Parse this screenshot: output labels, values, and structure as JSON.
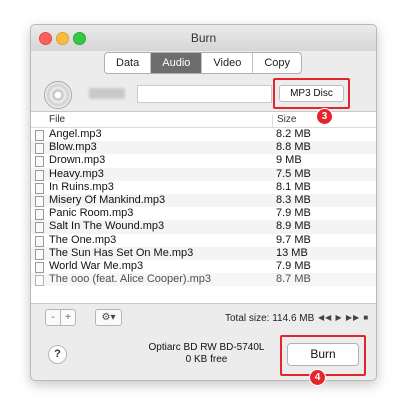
{
  "window": {
    "title": "Burn"
  },
  "tabs": [
    {
      "label": "Data",
      "active": false
    },
    {
      "label": "Audio",
      "active": true
    },
    {
      "label": "Video",
      "active": false
    },
    {
      "label": "Copy",
      "active": false
    }
  ],
  "disc": {
    "name_value": "",
    "format": "MP3 Disc"
  },
  "file_list": {
    "headers": {
      "file": "File",
      "size": "Size"
    },
    "rows": [
      {
        "name": "Angel.mp3",
        "size": "8.2 MB"
      },
      {
        "name": "Blow.mp3",
        "size": "8.8 MB"
      },
      {
        "name": "Drown.mp3",
        "size": "9 MB"
      },
      {
        "name": "Heavy.mp3",
        "size": "7.5 MB"
      },
      {
        "name": "In Ruins.mp3",
        "size": "8.1 MB"
      },
      {
        "name": "Misery Of Mankind.mp3",
        "size": "8.3 MB"
      },
      {
        "name": "Panic Room.mp3",
        "size": "7.9 MB"
      },
      {
        "name": "Salt In The Wound.mp3",
        "size": "8.9 MB"
      },
      {
        "name": "The One.mp3",
        "size": "9.7 MB"
      },
      {
        "name": "The Sun Has Set On Me.mp3",
        "size": "13 MB"
      },
      {
        "name": "World War Me.mp3",
        "size": "7.9 MB"
      },
      {
        "name": "The ooo (feat. Alice Cooper).mp3",
        "size": "8.7 MB"
      }
    ]
  },
  "bottom_bar": {
    "minus": "-",
    "plus": "+",
    "gear": "⚙▾",
    "total_size": "Total size: 114.6 MB",
    "transport": "◀◀ ▶ ▶▶ ■"
  },
  "footer": {
    "help": "?",
    "drive_name": "Optiarc BD RW BD-5740L",
    "drive_free": "0 KB free",
    "burn_label": "Burn"
  },
  "annotations": {
    "callout_1": "3",
    "callout_2": "4",
    "color": "#e3262b"
  }
}
